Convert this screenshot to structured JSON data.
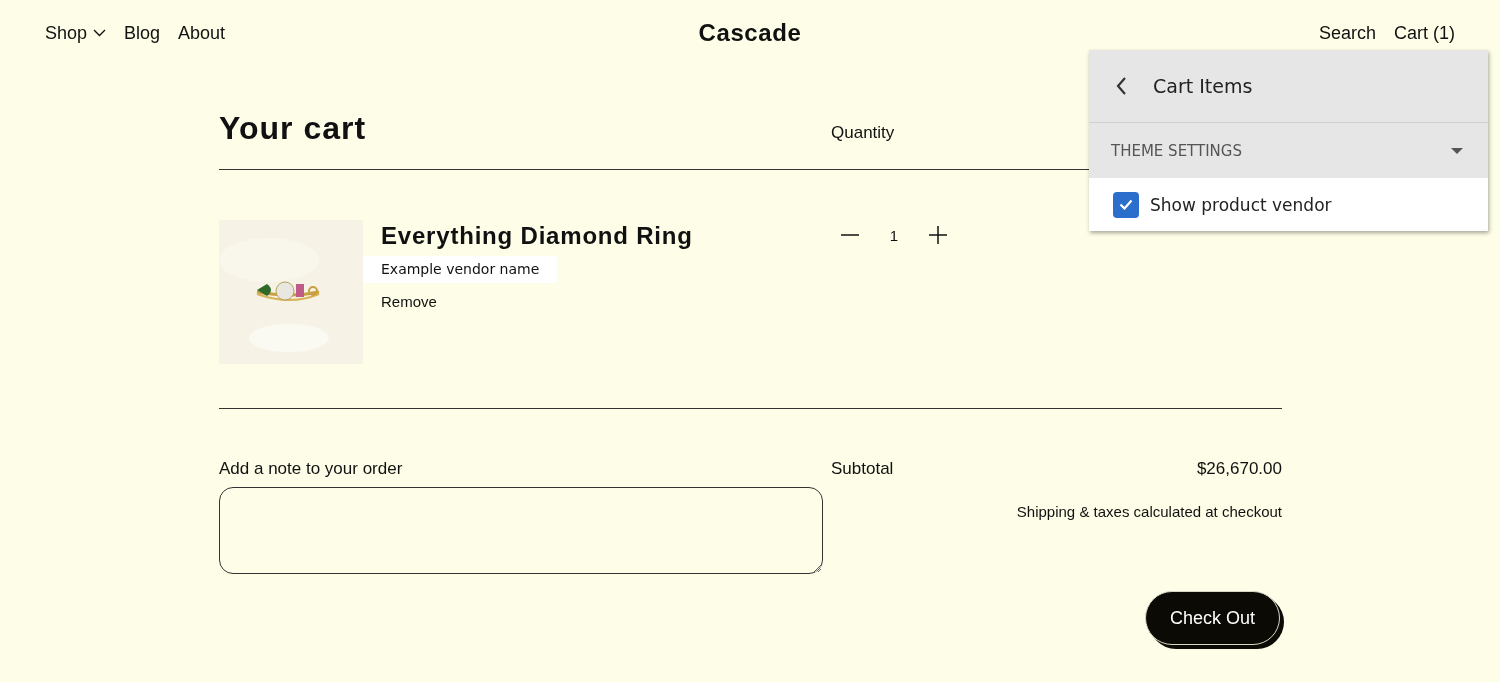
{
  "header": {
    "nav": [
      {
        "label": "Shop",
        "has_dropdown": true
      },
      {
        "label": "Blog",
        "has_dropdown": false
      },
      {
        "label": "About",
        "has_dropdown": false
      }
    ],
    "logo": "Cascade",
    "actions": [
      "Search",
      "Cart (1)"
    ]
  },
  "cart": {
    "title": "Your cart",
    "columns": [
      "Quantity"
    ],
    "items": [
      {
        "name": "Everything Diamond Ring",
        "vendor": "Example vendor name",
        "remove": "Remove",
        "quantity": "1"
      }
    ],
    "note": {
      "label": "Add a note to your order"
    },
    "subtotal": {
      "label": "Subtotal",
      "amount": "$26,670.00"
    },
    "shipping_note": "Shipping & taxes calculated at checkout",
    "checkout": "Check Out"
  },
  "editor": {
    "title": "Cart Items",
    "section": {
      "label": "THEME SETTINGS",
      "expanded": true
    },
    "settings": [
      {
        "label": "Show product vendor",
        "checked": true
      }
    ]
  }
}
